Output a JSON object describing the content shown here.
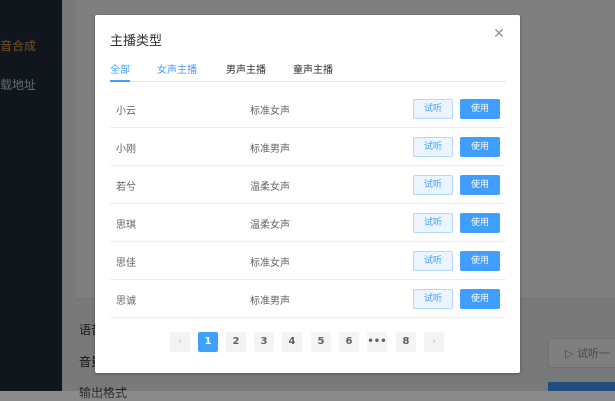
{
  "background": {
    "sidebar_items": [
      "音合成",
      "载地址"
    ],
    "labels": [
      "语音",
      "音量",
      "输出格式"
    ],
    "listen_button": "试听一"
  },
  "dialog": {
    "title": "主播类型",
    "close_icon": "close-icon",
    "tabs": [
      {
        "label": "全部",
        "active": true
      },
      {
        "label": "女声主播",
        "active": false
      },
      {
        "label": "男声主播",
        "active": false
      },
      {
        "label": "童声主播",
        "active": false
      }
    ],
    "listen_label": "试听",
    "use_label": "使用",
    "rows": [
      {
        "name": "小云",
        "type": "标准女声"
      },
      {
        "name": "小刚",
        "type": "标准男声"
      },
      {
        "name": "若兮",
        "type": "温柔女声"
      },
      {
        "name": "思琪",
        "type": "温柔女声"
      },
      {
        "name": "思佳",
        "type": "标准女声"
      },
      {
        "name": "思诚",
        "type": "标准男声"
      }
    ],
    "pagination": {
      "prev": "‹",
      "next": "›",
      "pages": [
        "1",
        "2",
        "3",
        "4",
        "5",
        "6",
        "•••",
        "8"
      ],
      "current": "1"
    }
  },
  "colors": {
    "primary": "#409eff",
    "sidebar_bg": "#1f2d3d",
    "sidebar_active": "#e6a23c"
  }
}
